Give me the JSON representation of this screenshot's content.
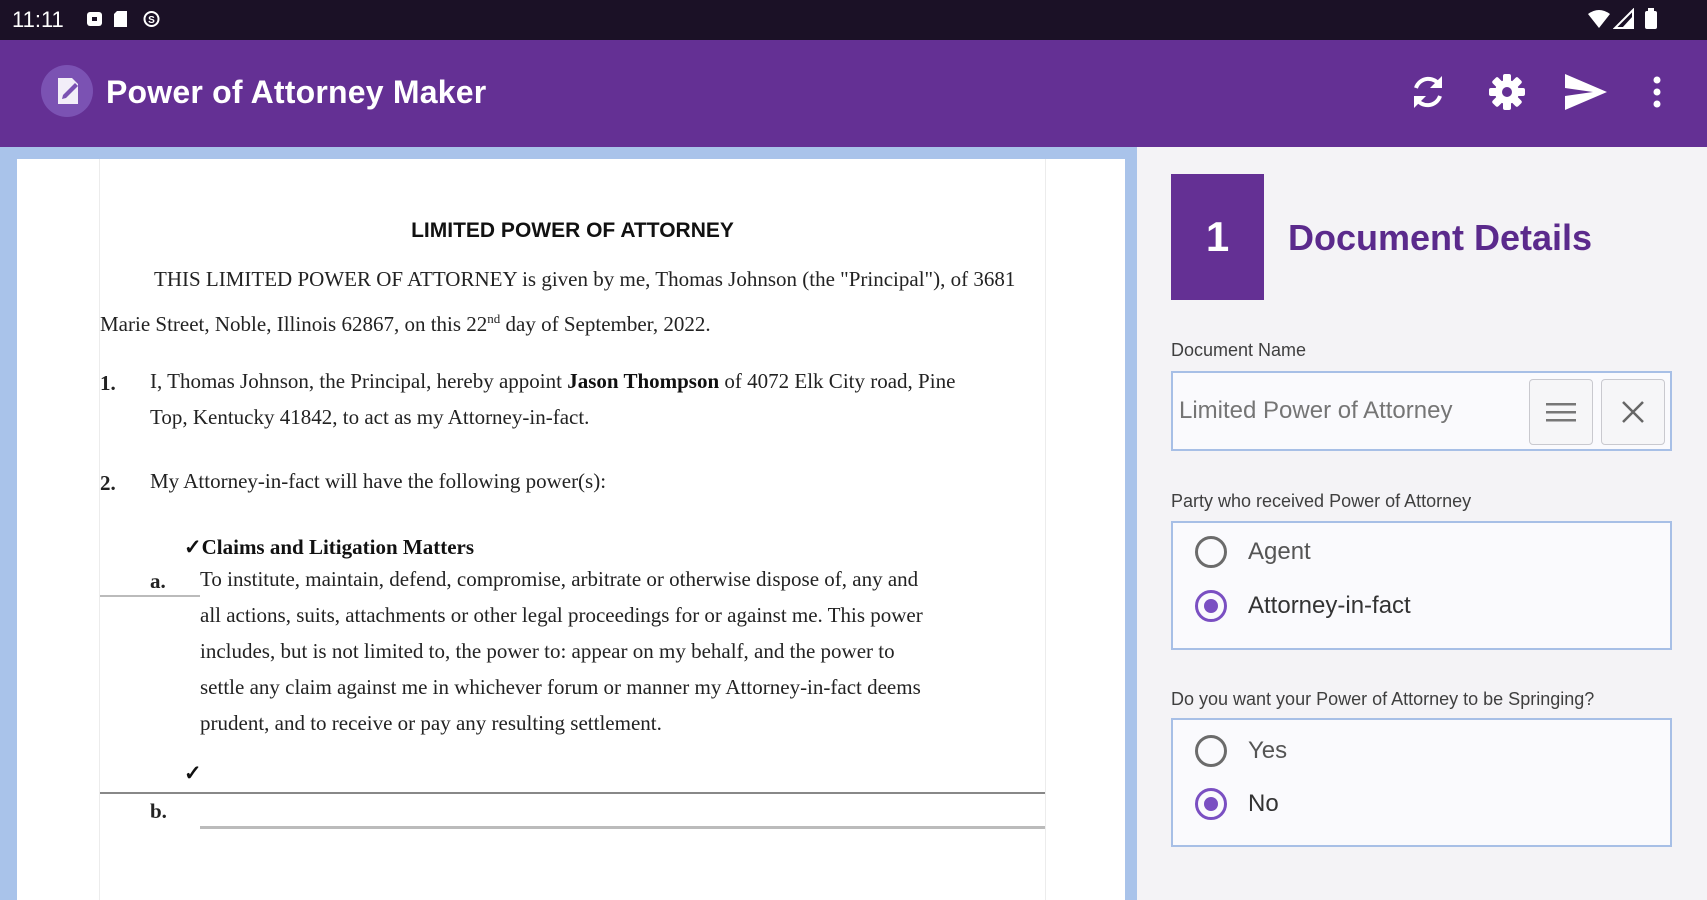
{
  "status_bar": {
    "time": "11:11"
  },
  "app_bar": {
    "title": "Power of Attorney Maker",
    "actions": [
      "refresh-icon",
      "settings-gear-icon",
      "send-icon",
      "more-vert-icon"
    ]
  },
  "document": {
    "title": "LIMITED POWER OF ATTORNEY",
    "intro_line1": "THIS LIMITED POWER OF ATTORNEY is given by me, Thomas Johnson (the \"Principal\"), of 3681",
    "intro_line2_pre": "Marie Street, Noble, Illinois 62867, on this 22",
    "intro_line2_sup": "nd",
    "intro_line2_post": " day of September, 2022.",
    "item1_num": "1.",
    "item1_pre": "I, Thomas Johnson, the Principal, hereby appoint ",
    "item1_agent": "Jason Thompson",
    "item1_post": " of 4072 Elk City road, Pine",
    "item1_line2": "Top, Kentucky 41842, to act as my Attorney-in-fact.",
    "item2_num": "2.",
    "item2_text": "My Attorney-in-fact will have the following power(s):",
    "check_mark": "✓",
    "power_a_title": "Claims and Litigation Matters",
    "power_a_letter": "a.",
    "power_a_lines": [
      "To institute, maintain, defend, compromise, arbitrate or otherwise dispose of, any and",
      "all actions, suits, attachments or other legal proceedings for or against me. This power",
      "includes, but is not limited to, the power to: appear on my behalf, and the power to",
      "settle any claim against me in whichever forum or manner my Attorney-in-fact deems",
      "prudent, and to receive or pay any resulting settlement."
    ],
    "power_b_check": "✓",
    "power_b_letter": "b."
  },
  "panel": {
    "step_number": "1",
    "step_title": "Document Details",
    "doc_name_label": "Document Name",
    "doc_name_placeholder": "Limited Power of Attorney",
    "doc_name_value": "",
    "party_label": "Party who received Power of Attorney",
    "party_options": [
      {
        "label": "Agent",
        "selected": false
      },
      {
        "label": "Attorney-in-fact",
        "selected": true
      }
    ],
    "springing_label": "Do you want your Power of Attorney to be Springing?",
    "springing_options": [
      {
        "label": "Yes",
        "selected": false
      },
      {
        "label": "No",
        "selected": true
      }
    ]
  },
  "colors": {
    "app_bar": "#643094",
    "status_bar": "#1b1126",
    "accent": "#7a4fc2",
    "preview_frame": "#a9c3ea",
    "title_text": "#5b2a8c"
  }
}
